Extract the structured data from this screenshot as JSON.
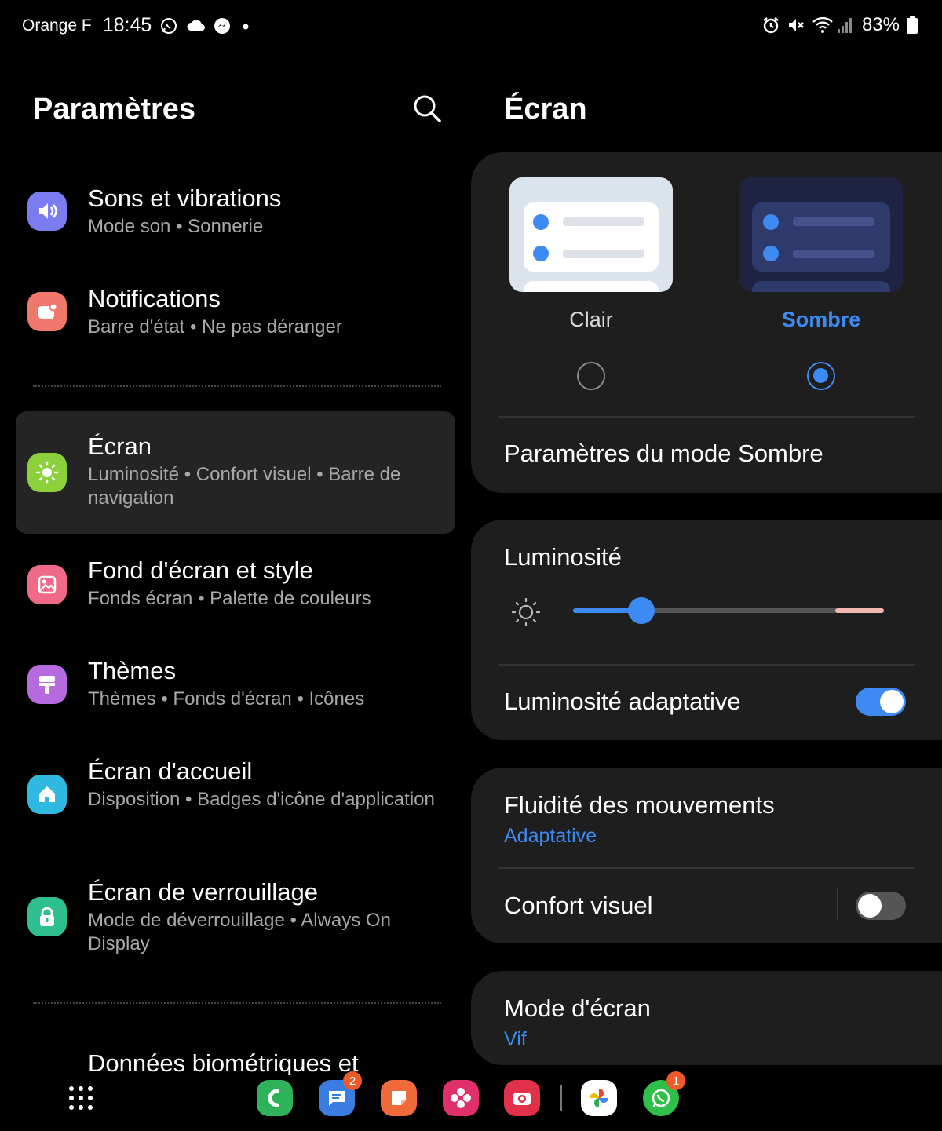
{
  "status_bar": {
    "carrier": "Orange F",
    "time": "18:45",
    "battery": "83%"
  },
  "left": {
    "title": "Paramètres",
    "items": [
      {
        "title": "Sons et vibrations",
        "subtitle": "Mode son • Sonnerie",
        "icon": "speaker-icon",
        "color": "#7a7cf0"
      },
      {
        "title": "Notifications",
        "subtitle": "Barre d'état • Ne pas déranger",
        "icon": "notification-icon",
        "color": "#f0786a"
      },
      {
        "title": "Écran",
        "subtitle": "Luminosité • Confort visuel • Barre de navigation",
        "icon": "sun-icon",
        "color": "#8cd13c"
      },
      {
        "title": "Fond d'écran et style",
        "subtitle": "Fonds écran • Palette de couleurs",
        "icon": "wallpaper-icon",
        "color": "#f06a88"
      },
      {
        "title": "Thèmes",
        "subtitle": "Thèmes • Fonds d'écran • Icônes",
        "icon": "brush-icon",
        "color": "#b56ae0"
      },
      {
        "title": "Écran d'accueil",
        "subtitle": "Disposition • Badges d'icône d'application",
        "icon": "home-icon",
        "color": "#2fb8e0"
      },
      {
        "title": "Écran de verrouillage",
        "subtitle": "Mode de déverrouillage • Always On Display",
        "icon": "lock-icon",
        "color": "#2fbf8f"
      },
      {
        "title": "Données biométriques et",
        "subtitle": "",
        "icon": "",
        "color": ""
      }
    ]
  },
  "right": {
    "title": "Écran",
    "theme": {
      "light_label": "Clair",
      "dark_label": "Sombre",
      "selected": "dark",
      "accent": "#3d8bf2"
    },
    "dark_mode_settings": "Paramètres du mode Sombre",
    "brightness": {
      "label": "Luminosité",
      "level": 0.22
    },
    "adaptive_brightness": {
      "label": "Luminosité adaptative",
      "on": true
    },
    "motion": {
      "label": "Fluidité des mouvements",
      "value": "Adaptative"
    },
    "eye_comfort": {
      "label": "Confort visuel",
      "on": false
    },
    "screen_mode": {
      "label": "Mode d'écran",
      "value": "Vif"
    }
  },
  "dock": {
    "apps": [
      {
        "name": "phone-app-icon",
        "badge": ""
      },
      {
        "name": "messages-app-icon",
        "badge": "2"
      },
      {
        "name": "notes-app-icon",
        "badge": ""
      },
      {
        "name": "gallery-app-icon",
        "badge": ""
      },
      {
        "name": "camera-app-icon",
        "badge": ""
      },
      {
        "name": "photos-app-icon",
        "badge": ""
      },
      {
        "name": "whatsapp-app-icon",
        "badge": "1"
      }
    ]
  }
}
